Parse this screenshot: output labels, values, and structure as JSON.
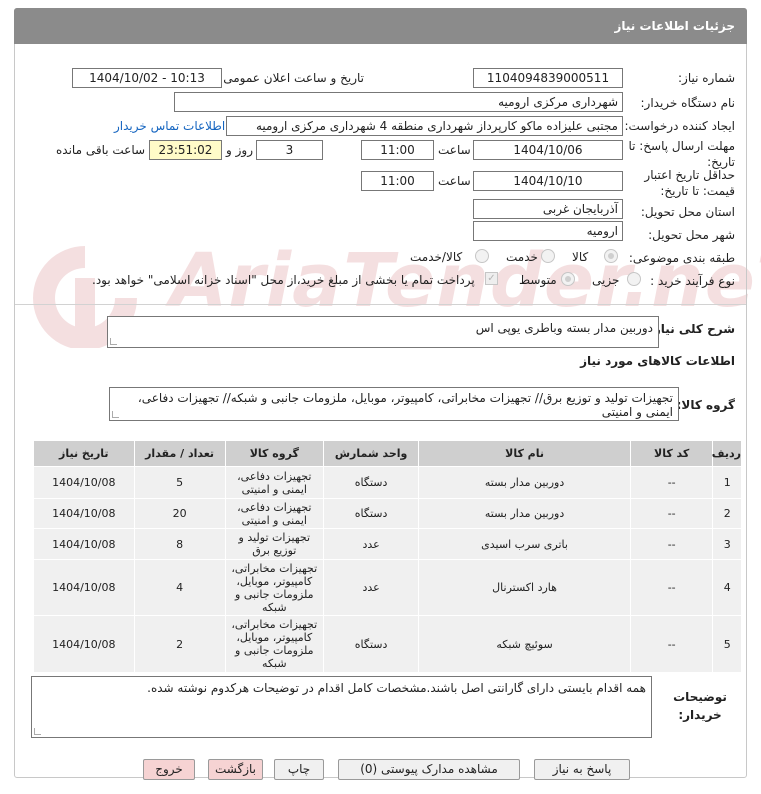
{
  "header": {
    "title": "جزئیات اطلاعات نیاز"
  },
  "watermark": {
    "text": "AriaTender.neT"
  },
  "form": {
    "need_number_label": "شماره نیاز:",
    "need_number": "1104094839000511",
    "announce_label": "تاریخ و ساعت اعلان عمومی:",
    "announce_value": "1404/10/02 - 10:13",
    "buyer_org_label": "نام دستگاه خریدار:",
    "buyer_org": "شهرداری مرکزی ارومیه",
    "creator_label": "ایجاد کننده درخواست:",
    "creator": "مجتبی علیزاده ماکو کارپرداز شهرداری منطقه 4 شهرداری مرکزی ارومیه",
    "contact_link": "اطلاعات تماس خریدار",
    "reply_deadline_label": "مهلت ارسال پاسخ: تا تاریخ:",
    "reply_date": "1404/10/06",
    "time_label": "ساعت",
    "reply_time": "11:00",
    "days": "3",
    "days_label": "روز و",
    "remaining": "23:51:02",
    "remaining_label": "ساعت باقی مانده",
    "price_validity_label": "حداقل تاریخ اعتبار قیمت: تا تاریخ:",
    "validity_date": "1404/10/10",
    "validity_time": "11:00",
    "province_label": "استان محل تحویل:",
    "province": "آذربایجان غربی",
    "city_label": "شهر محل تحویل:",
    "city": "ارومیه",
    "category_label": "طبقه بندی موضوعی:",
    "category_options": [
      "کالا",
      "خدمت",
      "کالا/خدمت"
    ],
    "category_selected": "کالا",
    "process_label": "نوع فرآیند خرید :",
    "process_options": [
      "جزیی",
      "متوسط"
    ],
    "process_selected": "جزیی",
    "payment_note": "پرداخت تمام یا بخشی از مبلغ خرید،از محل \"اسناد خزانه اسلامی\" خواهد بود."
  },
  "description": {
    "label": "شرح کلی نیاز:",
    "value": "دوربین مدار بسته وباطری یوپی اس"
  },
  "goods": {
    "section_title": "اطلاعات کالاهای مورد نیاز",
    "group_label": "گروه کالا:",
    "group_value": "تجهیزات تولید و توزیع برق// تجهیزات مخابراتی، کامپیوتر، موبایل، ملزومات جانبی و شبکه// تجهیزات دفاعی، ایمنی و امنیتی",
    "columns": [
      "ردیف",
      "کد کالا",
      "نام کالا",
      "واحد شمارش",
      "گروه کالا",
      "تعداد / مقدار",
      "تاریخ نیاز"
    ],
    "rows": [
      {
        "row": "1",
        "code": "--",
        "name": "دوربین مدار بسته",
        "unit": "دستگاه",
        "group": "تجهیزات دفاعی، ایمنی و امنیتی",
        "qty": "5",
        "date": "1404/10/08"
      },
      {
        "row": "2",
        "code": "--",
        "name": "دوربین مدار بسته",
        "unit": "دستگاه",
        "group": "تجهیزات دفاعی، ایمنی و امنیتی",
        "qty": "20",
        "date": "1404/10/08"
      },
      {
        "row": "3",
        "code": "--",
        "name": "باتری سرب اسیدی",
        "unit": "عدد",
        "group": "تجهیزات تولید و توزیع برق",
        "qty": "8",
        "date": "1404/10/08"
      },
      {
        "row": "4",
        "code": "--",
        "name": "هارد اکسترنال",
        "unit": "عدد",
        "group": "تجهیزات مخابراتی، کامپیوتر، موبایل، ملزومات جانبی و شبکه",
        "qty": "4",
        "date": "1404/10/08"
      },
      {
        "row": "5",
        "code": "--",
        "name": "سوئیچ شبکه",
        "unit": "دستگاه",
        "group": "تجهیزات مخابراتی، کامپیوتر، موبایل، ملزومات جانبی و شبکه",
        "qty": "2",
        "date": "1404/10/08"
      }
    ]
  },
  "buyer_notes": {
    "label": "توضیحات خریدار:",
    "value": "همه اقدام بایستی دارای گارانتی اصل باشند.مشخصات کامل اقدام در توضیحات هرکدوم نوشته شده."
  },
  "buttons": {
    "reply": "پاسخ به نیاز",
    "attachments": "مشاهده مدارک پیوستی (0)",
    "print": "چاپ",
    "back": "بازگشت",
    "exit": "خروج"
  }
}
